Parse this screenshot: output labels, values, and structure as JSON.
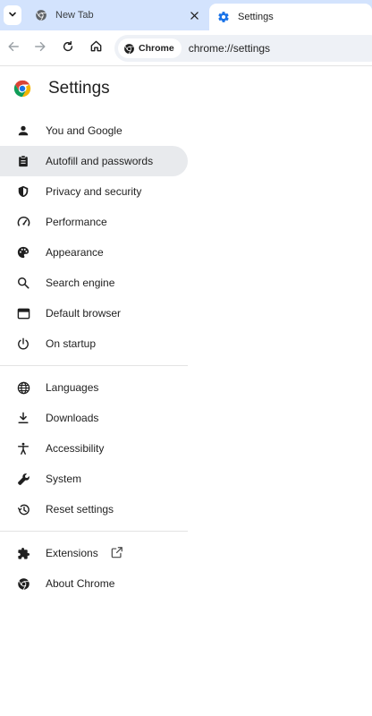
{
  "tabs": [
    {
      "title": "New Tab",
      "icon": "chrome-icon"
    },
    {
      "title": "Settings",
      "icon": "gear-icon",
      "active": true
    }
  ],
  "toolbar": {
    "chip_label": "Chrome",
    "url": "chrome://settings"
  },
  "page": {
    "title": "Settings"
  },
  "menu": {
    "group1": [
      {
        "label": "You and Google",
        "icon": "person-icon"
      },
      {
        "label": "Autofill and passwords",
        "icon": "clipboard-icon",
        "active": true
      },
      {
        "label": "Privacy and security",
        "icon": "shield-icon"
      },
      {
        "label": "Performance",
        "icon": "speedometer-icon"
      },
      {
        "label": "Appearance",
        "icon": "palette-icon"
      },
      {
        "label": "Search engine",
        "icon": "search-icon"
      },
      {
        "label": "Default browser",
        "icon": "browser-window-icon"
      },
      {
        "label": "On startup",
        "icon": "power-icon"
      }
    ],
    "group2": [
      {
        "label": "Languages",
        "icon": "globe-icon"
      },
      {
        "label": "Downloads",
        "icon": "download-icon"
      },
      {
        "label": "Accessibility",
        "icon": "accessibility-icon"
      },
      {
        "label": "System",
        "icon": "wrench-icon"
      },
      {
        "label": "Reset settings",
        "icon": "history-icon"
      }
    ],
    "group3": [
      {
        "label": "Extensions",
        "icon": "puzzle-icon"
      },
      {
        "label": "About Chrome",
        "icon": "chrome-icon"
      }
    ]
  },
  "colors": {
    "tabstrip": "#d3e3fd",
    "active_item": "#e8eaed",
    "accent": "#1a73e8"
  }
}
